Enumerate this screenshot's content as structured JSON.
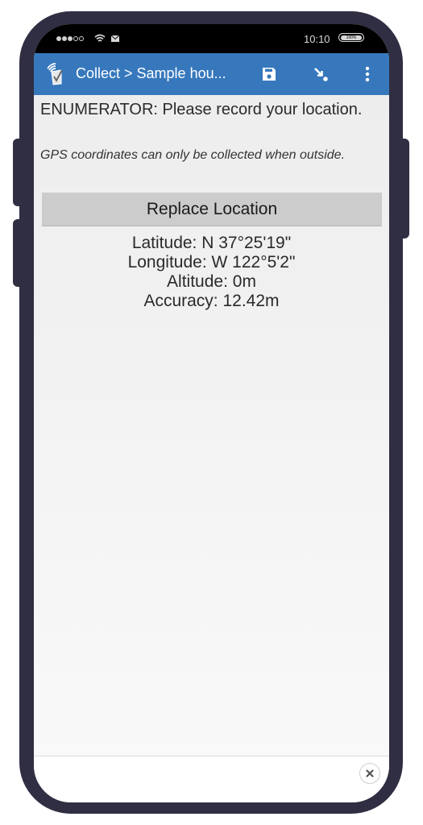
{
  "status_bar": {
    "signal": {
      "filled": 3,
      "total": 5
    },
    "icons": [
      "wifi-icon",
      "mail-icon"
    ],
    "time": "10:10",
    "battery": "100%"
  },
  "app_bar": {
    "logo_icon": "odk-collect-logo-icon",
    "title": "Collect > Sample hou...",
    "actions": [
      {
        "name": "save",
        "icon": "floppy-disk-icon"
      },
      {
        "name": "go-to",
        "icon": "arrow-jump-icon"
      },
      {
        "name": "more",
        "icon": "vertical-dots-icon"
      }
    ],
    "color": "#3778bd"
  },
  "question": {
    "label": "ENUMERATOR: Please record your location.",
    "hint": "GPS coordinates can only be collected when outside."
  },
  "replace_button": {
    "label": "Replace Location"
  },
  "location": {
    "latitude": "Latitude: N 37°25'19\"",
    "longitude": "Longitude: W 122°5'2\"",
    "altitude": "Altitude: 0m",
    "accuracy": "Accuracy: 12.42m"
  },
  "footer": {
    "close_icon": "close-icon"
  }
}
